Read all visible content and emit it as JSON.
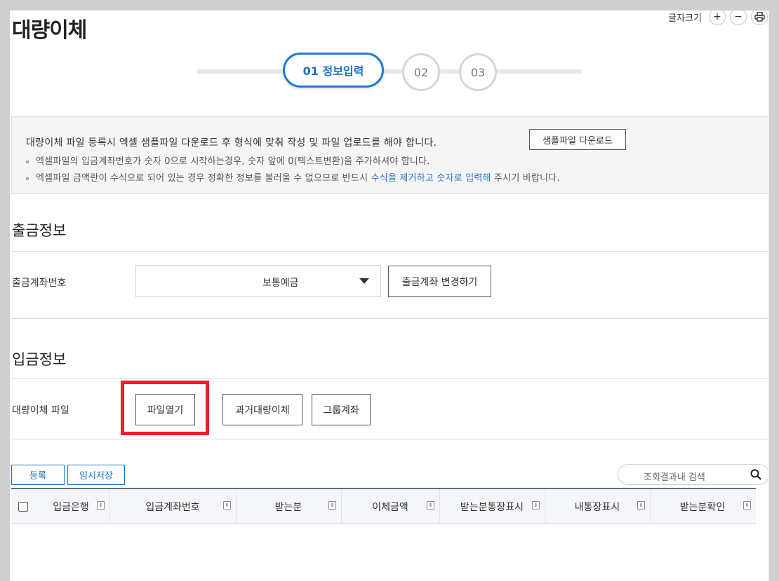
{
  "page": {
    "title": "대량이체",
    "font_size_label": "글자크기",
    "font_plus": "+",
    "font_minus": "−"
  },
  "steps": [
    {
      "label": "01 정보입력",
      "active": true
    },
    {
      "label": "02",
      "active": false
    },
    {
      "label": "03",
      "active": false
    }
  ],
  "notice": {
    "main": "대량이체 파일 등록시 엑셀 샘플파일 다운로드 후 형식에 맞춰 작성 및 파일 업로드를 해야 합니다.",
    "sample_download": "샘플파일 다운로드",
    "line1": "엑셀파일의 입금계좌번호가 숫자 0으로 시작하는경우, 숫자 앞에 0(텍스트변환)을 주가하셔야 합니다.",
    "line2_pre": "엑셀파일 금액란이 수식으로 되어 있는 경우 정확한 정보를 불러올 수 없으므로 반드시 ",
    "line2_hl": "수식을 제거하고 숫자로 입력해",
    "line2_post": " 주시기 바랍니다."
  },
  "withdraw": {
    "section_title": "출금정보",
    "account_label": "출금계좌번호",
    "account_type": "보통예금",
    "change_button": "출금계좌 변경하기"
  },
  "deposit": {
    "section_title": "입금정보",
    "file_label": "대량이체 파일",
    "open_file": "파일열기",
    "past_transfer": "과거대량이체",
    "group_account": "그룹계좌"
  },
  "actions": {
    "register": "등록",
    "temp_save": "임시저장",
    "search_placeholder": "조회결과내 검색"
  },
  "grid": {
    "columns": [
      "입금은행",
      "입금계좌번호",
      "받는분",
      "이체금액",
      "받는분통장표시",
      "내통장표시",
      "받는분확인"
    ]
  },
  "colors": {
    "accent": "#1d7bd6",
    "highlight": "#e8212a",
    "link": "#2a6fcf"
  }
}
